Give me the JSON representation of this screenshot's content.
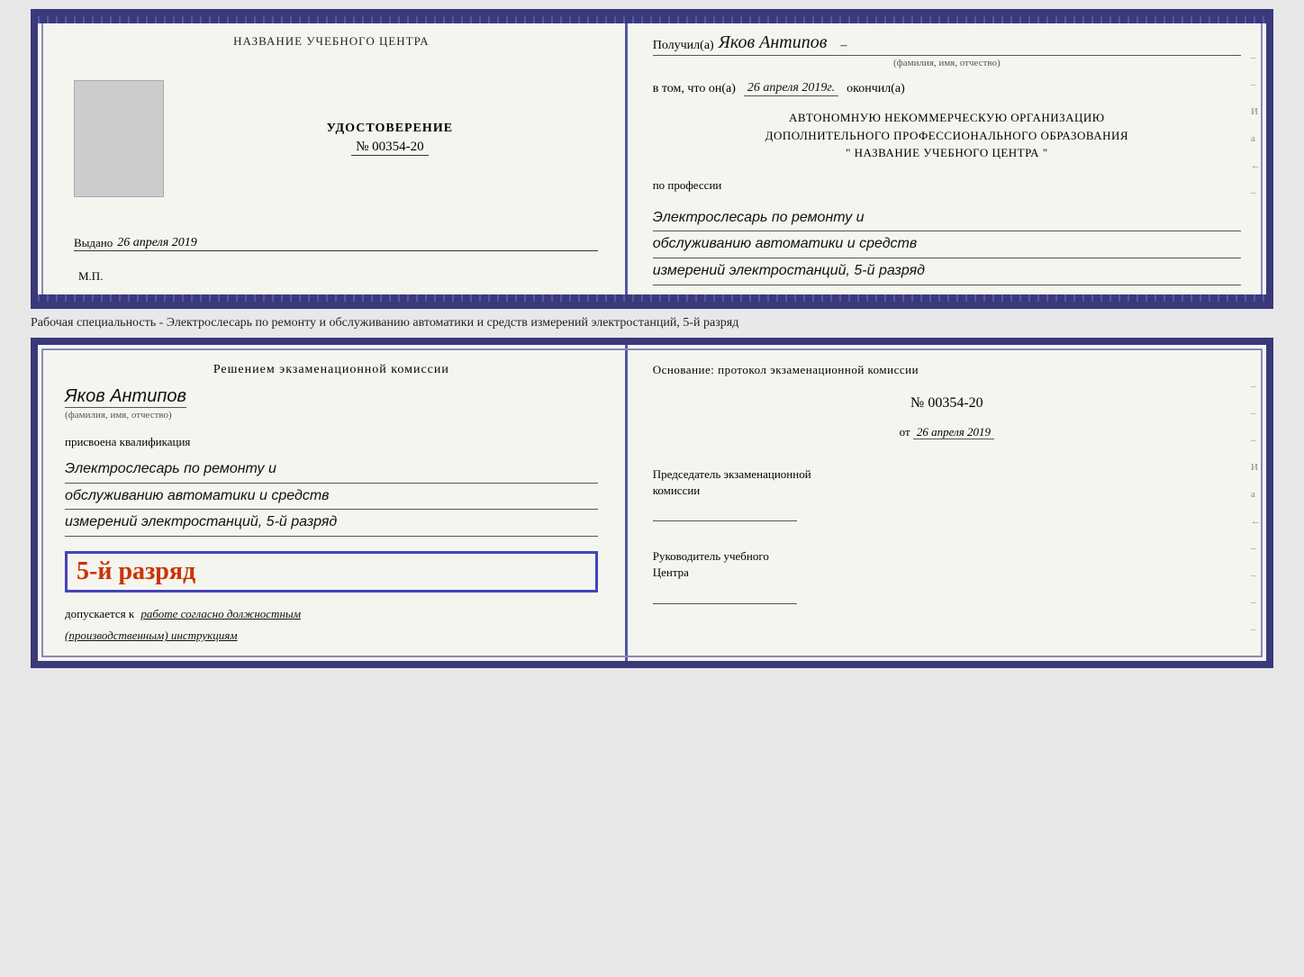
{
  "colors": {
    "border": "#3a3a7a",
    "strip": "#5555aa",
    "background": "#f5f5f0",
    "handwriting": "#111111",
    "red": "#cc3300",
    "blue": "#4444bb"
  },
  "topCert": {
    "left": {
      "title": "НАЗВАНИЕ УЧЕБНОГО ЦЕНТРА",
      "udostoverenie_label": "УДОСТОВЕРЕНИЕ",
      "number": "№ 00354-20",
      "vydano_label": "Выдано",
      "vydano_date": "26 апреля 2019",
      "mp": "М.П."
    },
    "right": {
      "poluchil_label": "Получил(а)",
      "fio_value": "Яков Антипов",
      "fio_subtitle": "(фамилия, имя, отчество)",
      "vtom_label": "в том, что он(а)",
      "vtom_date": "26 апреля 2019г.",
      "okончил_label": "окончил(а)",
      "org_line1": "АВТОНОМНУЮ НЕКОММЕРЧЕСКУЮ ОРГАНИЗАЦИЮ",
      "org_line2": "ДОПОЛНИТЕЛЬНОГО ПРОФЕССИОНАЛЬНОГО ОБРАЗОВАНИЯ",
      "org_line3": "\"  НАЗВАНИЕ УЧЕБНОГО ЦЕНТРА  \"",
      "po_professii_label": "по профессии",
      "profession_line1": "Электрослесарь по ремонту и",
      "profession_line2": "обслуживанию автоматики и средств",
      "profession_line3": "измерений электростанций, 5-й разряд"
    }
  },
  "separator": {
    "text": "Рабочая специальность - Электрослесарь по ремонту и обслуживанию автоматики и средств измерений электростанций, 5-й разряд"
  },
  "bottomCert": {
    "left": {
      "resheniem_label": "Решением экзаменационной комиссии",
      "fio_value": "Яков Антипов",
      "fio_subtitle": "(фамилия, имя, отчество)",
      "prisvoena_label": "присвоена квалификация",
      "profession_line1": "Электрослесарь по ремонту и",
      "profession_line2": "обслуживанию автоматики и средств",
      "profession_line3": "измерений электростанций, 5-й разряд",
      "razryad_highlight": "5-й разряд",
      "dopuskaetsya_label": "допускается к",
      "dopuskaetsya_value": "работе согласно должностным",
      "dopuskaetsya_value2": "(производственным) инструкциям"
    },
    "right": {
      "osnovanie_label": "Основание: протокол экзаменационной комиссии",
      "number": "№  00354-20",
      "ot_label": "от",
      "ot_date": "26 апреля 2019",
      "predsedatel_label": "Председатель экзаменационной",
      "predsedatel_label2": "комиссии",
      "rukovoditel_label": "Руководитель учебного",
      "rukovoditel_label2": "Центра"
    }
  }
}
